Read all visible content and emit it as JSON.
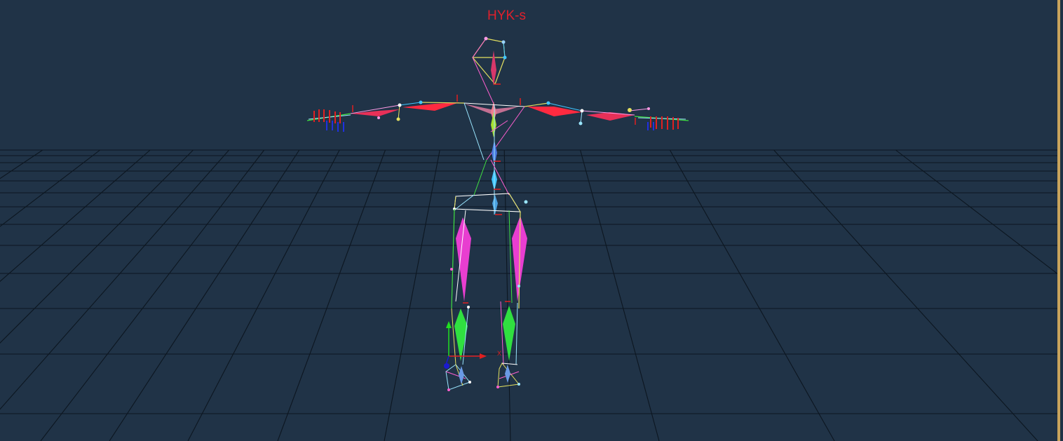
{
  "viewport": {
    "character_name": "HYK-s",
    "gizmo_axis_label": "X",
    "colors": {
      "background": "#203347",
      "grid_line": "#0c1620",
      "title": "#e0202c",
      "frame_edge": "#c9a45c"
    }
  }
}
